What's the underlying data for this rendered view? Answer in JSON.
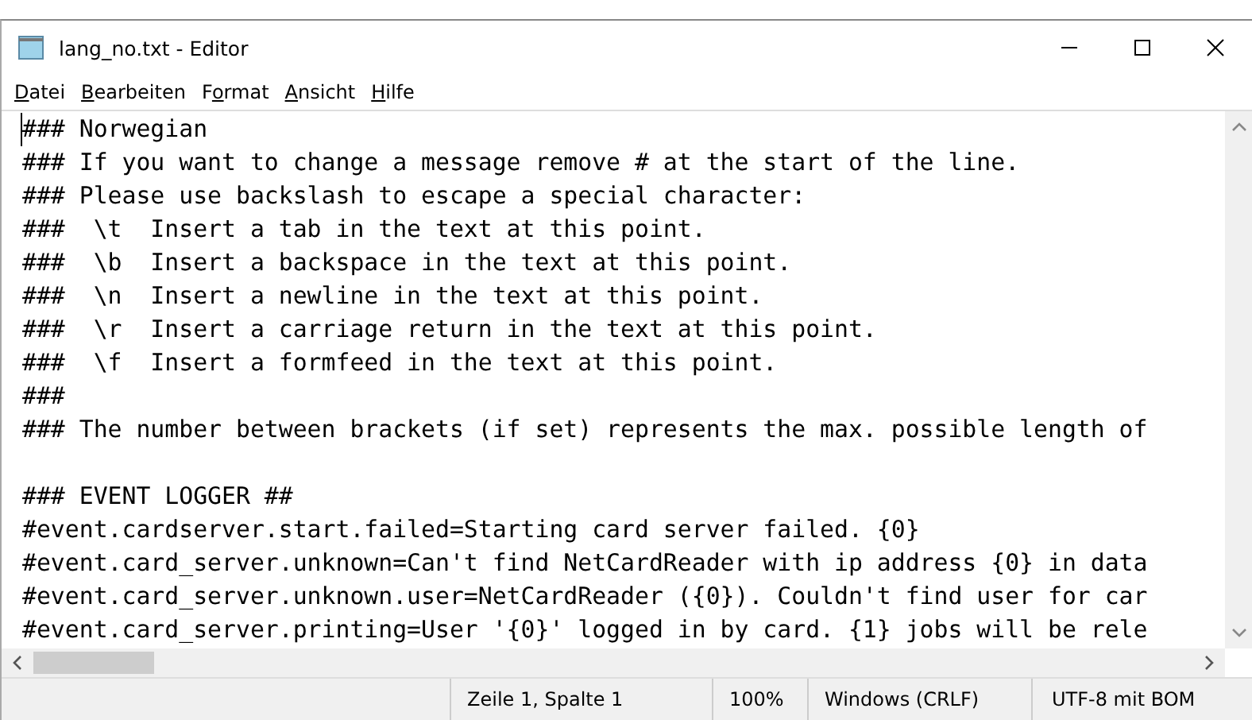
{
  "window": {
    "title": "lang_no.txt - Editor"
  },
  "menu": [
    {
      "mnemonic": "D",
      "rest": "atei"
    },
    {
      "mnemonic": "B",
      "rest": "earbeiten"
    },
    {
      "before": "F",
      "mnemonic": "o",
      "rest": "rmat"
    },
    {
      "mnemonic": "A",
      "rest": "nsicht"
    },
    {
      "mnemonic": "H",
      "rest": "ilfe"
    }
  ],
  "editor": {
    "lines": [
      {
        "kind": "text",
        "text": "### Norwegian"
      },
      {
        "kind": "text",
        "text": "### If you want to change a message remove # at the start of the line."
      },
      {
        "kind": "text",
        "text": "### Please use backslash to escape a special character:"
      },
      {
        "kind": "text",
        "text": "###  \\t  Insert a tab in the text at this point."
      },
      {
        "kind": "text",
        "text": "###  \\b  Insert a backspace in the text at this point."
      },
      {
        "kind": "text",
        "text": "###  \\n  Insert a newline in the text at this point."
      },
      {
        "kind": "text",
        "text": "###  \\r  Insert a carriage return in the text at this point."
      },
      {
        "kind": "text",
        "text": "###  \\f  Insert a formfeed in the text at this point."
      },
      {
        "kind": "text",
        "text": "###"
      },
      {
        "kind": "text",
        "text": "### The number between brackets (if set) represents the max. possible length of"
      },
      {
        "kind": "blank"
      },
      {
        "kind": "text",
        "text": "### EVENT LOGGER ##"
      },
      {
        "kind": "text",
        "text": "#event.cardserver.start.failed=Starting card server failed. {0}"
      },
      {
        "kind": "text",
        "text": "#event.card_server.unknown=Can't find NetCardReader with ip address {0} in data"
      },
      {
        "kind": "text",
        "text": "#event.card_server.unknown.user=NetCardReader ({0}). Couldn't find user for car"
      },
      {
        "kind": "text",
        "text": "#event.card_server.printing=User '{0}' logged in by card. {1} jobs will be rele"
      }
    ]
  },
  "status_bar": [
    "Zeile 1, Spalte 1",
    "100%",
    "Windows (CRLF)",
    "UTF-8 mit BOM"
  ]
}
